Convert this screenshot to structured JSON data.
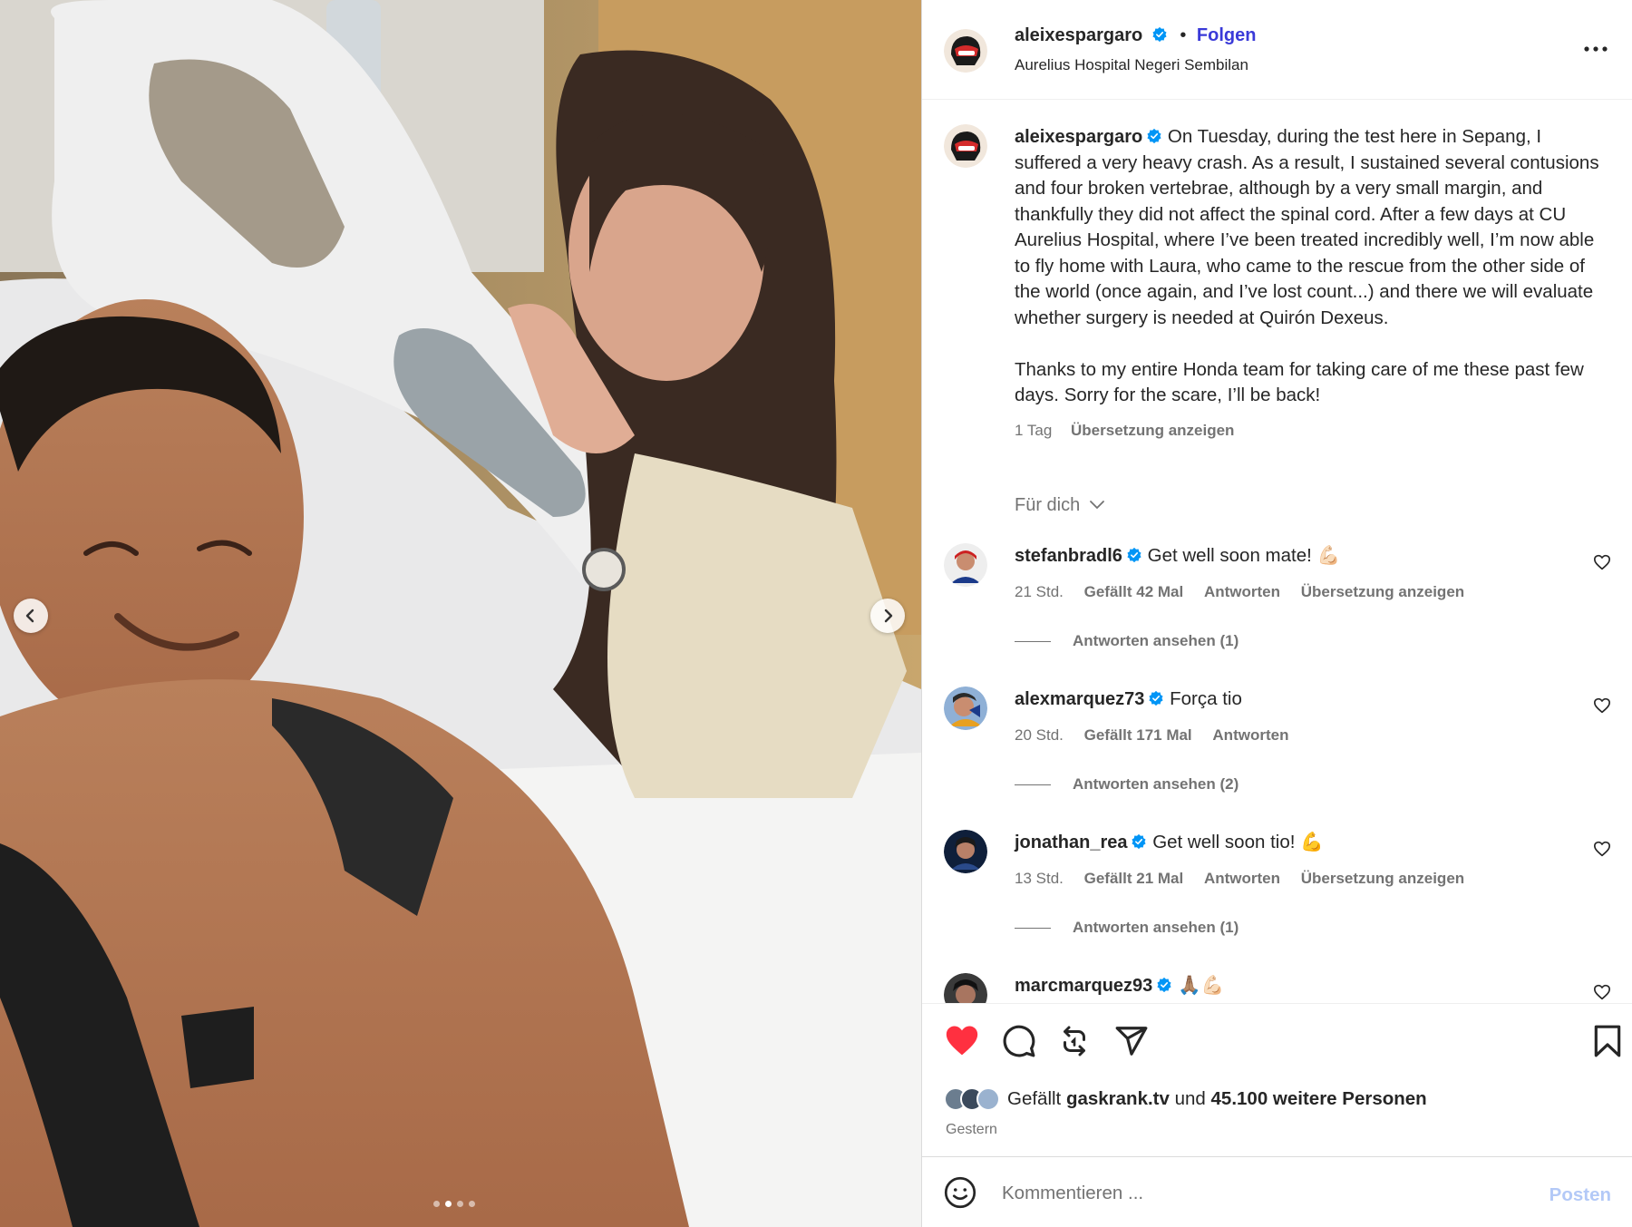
{
  "post": {
    "username": "aleixespargaro",
    "follow_label": "Folgen",
    "location": "Aurelius Hospital Negeri Sembilan",
    "caption_p1": "On Tuesday, during the test here in Sepang, I suffered a very heavy crash. As a result, I sustained several contusions and four broken vertebrae, although by a very small margin, and thankfully they did not affect the spinal cord. After a few days at CU Aurelius Hospital, where I’ve been treated incredibly well, I’m now able to fly home with Laura, who came to the rescue from the other side of the world (once again, and I’ve lost count...) and there we will evaluate whether surgery is needed at Quirón Dexeus.",
    "caption_p2": "Thanks to my entire Honda team for taking care of me these past few days. Sorry for the scare, I’ll be back!",
    "caption_time": "1 Tag",
    "translate_label": "Übersetzung anzeigen"
  },
  "filter_label": "Für dich",
  "comments": [
    {
      "username": "stefanbradl6",
      "text": "Get well soon mate! 💪🏻",
      "time": "21 Std.",
      "likes": "Gefällt 42 Mal",
      "reply": "Antworten",
      "translate": "Übersetzung anzeigen",
      "view_replies": "Antworten ansehen (1)"
    },
    {
      "username": "alexmarquez73",
      "text": "Força tio",
      "time": "20 Std.",
      "likes": "Gefällt 171 Mal",
      "reply": "Antworten",
      "translate": "",
      "view_replies": "Antworten ansehen (2)"
    },
    {
      "username": "jonathan_rea",
      "text": "Get well soon tio! 💪",
      "time": "13 Std.",
      "likes": "Gefällt 21 Mal",
      "reply": "Antworten",
      "translate": "Übersetzung anzeigen",
      "view_replies": "Antworten ansehen (1)"
    },
    {
      "username": "marcmarquez93",
      "text": "🙏🏽💪🏻",
      "time": "",
      "likes": "",
      "reply": "",
      "translate": "",
      "view_replies": ""
    }
  ],
  "likes_line": {
    "prefix": "Gefällt",
    "user": "gaskrank.tv",
    "middle": "und",
    "count": "45.100 weitere Personen"
  },
  "post_date": "Gestern",
  "compose": {
    "placeholder": "Kommentieren ...",
    "post_label": "Posten"
  },
  "carousel": {
    "slides": 4,
    "active_index": 1
  },
  "colors": {
    "like_red": "#ff3040",
    "link_blue": "#3a3ad8",
    "verified_blue": "#0095f6",
    "post_disabled": "#b3c9f7"
  },
  "icons": [
    "chevron-left-icon",
    "chevron-right-icon",
    "more-icon",
    "verified-icon",
    "heart-icon",
    "comment-icon",
    "repost-icon",
    "share-icon",
    "bookmark-icon",
    "smile-icon",
    "chevron-down-icon"
  ]
}
